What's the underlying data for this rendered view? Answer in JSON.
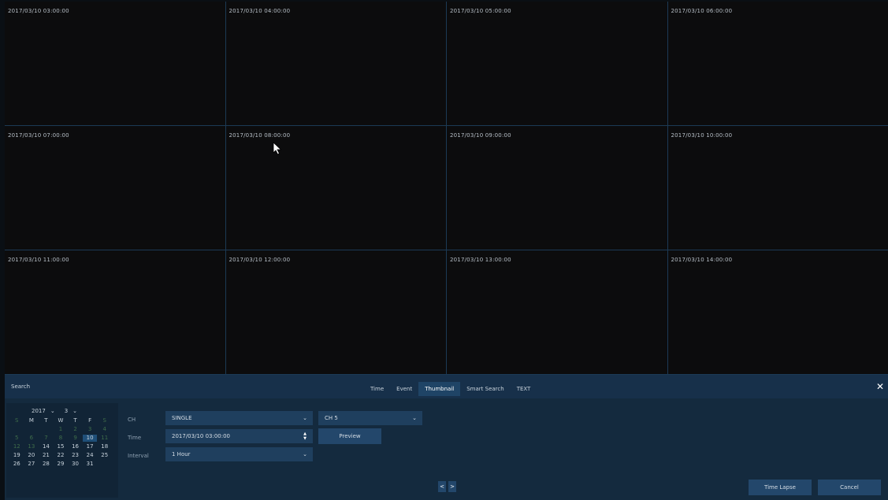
{
  "thumbnails": [
    "2017/03/10 03:00:00",
    "2017/03/10 04:00:00",
    "2017/03/10 05:00:00",
    "2017/03/10 06:00:00",
    "2017/03/10 07:00:00",
    "2017/03/10 08:00:00",
    "2017/03/10 09:00:00",
    "2017/03/10 10:00:00",
    "2017/03/10 11:00:00",
    "2017/03/10 12:00:00",
    "2017/03/10 13:00:00",
    "2017/03/10 14:00:00"
  ],
  "panel": {
    "title": "Search",
    "tabs": [
      "Time",
      "Event",
      "Thumbnail",
      "Smart Search",
      "TEXT"
    ],
    "active_tab": "Thumbnail",
    "close_icon": "close-icon"
  },
  "calendar": {
    "year": "2017",
    "month": "3",
    "weekdays": [
      "S",
      "M",
      "T",
      "W",
      "T",
      "F",
      "S"
    ],
    "days": [
      "",
      "",
      "",
      "1",
      "2",
      "3",
      "4",
      "5",
      "6",
      "7",
      "8",
      "9",
      "10",
      "11",
      "12",
      "13",
      "14",
      "15",
      "16",
      "17",
      "18",
      "19",
      "20",
      "21",
      "22",
      "23",
      "24",
      "25",
      "26",
      "27",
      "28",
      "29",
      "30",
      "31",
      ""
    ],
    "selected_day": "10",
    "colors": {
      "dim": "#3f6d4a",
      "selected": "#1f4f78"
    }
  },
  "form": {
    "ch_label": "CH",
    "ch_mode": "SINGLE",
    "ch_channel": "CH 5",
    "time_label": "Time",
    "time_value": "2017/03/10 03:00:00",
    "preview_label": "Preview",
    "interval_label": "Interval",
    "interval_value": "1 Hour"
  },
  "footer": {
    "prev": "<",
    "next": ">",
    "time_lapse": "Time Lapse",
    "cancel": "Cancel"
  }
}
